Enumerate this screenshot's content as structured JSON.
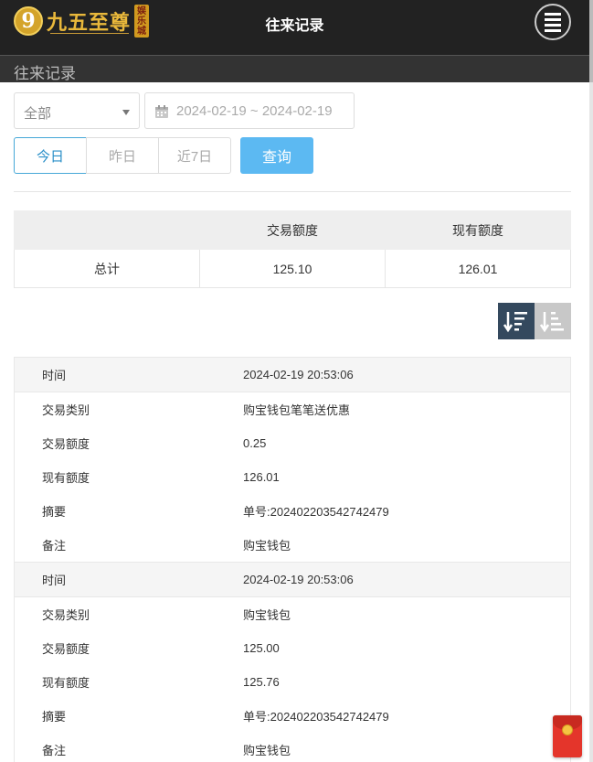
{
  "header": {
    "logo_mark": "9",
    "logo_text": "九五至尊",
    "logo_badge": "娱乐城",
    "title": "往来记录"
  },
  "subheader": {
    "title": "往来记录"
  },
  "filters": {
    "type_select": "全部",
    "date_range": "2024-02-19 ~ 2024-02-19",
    "quick_ranges": [
      "今日",
      "昨日",
      "近7日"
    ],
    "active_quick_range": "今日",
    "query_label": "查询"
  },
  "summary": {
    "columns": [
      "",
      "交易额度",
      "现有额度"
    ],
    "row": {
      "label": "总计",
      "trade_amount": "125.10",
      "balance": "126.01"
    }
  },
  "records": [
    {
      "time_label": "时间",
      "time": "2024-02-19 20:53:06",
      "type_label": "交易类别",
      "type": "购宝钱包笔笔送优惠",
      "amount_label": "交易额度",
      "amount": "0.25",
      "balance_label": "现有额度",
      "balance": "126.01",
      "summary_label": "摘要",
      "summary": "单号:202402203542742479",
      "note_label": "备注",
      "note": "购宝钱包"
    },
    {
      "time_label": "时间",
      "time": "2024-02-19 20:53:06",
      "type_label": "交易类别",
      "type": "购宝钱包",
      "amount_label": "交易额度",
      "amount": "125.00",
      "balance_label": "现有额度",
      "balance": "125.76",
      "summary_label": "摘要",
      "summary": "单号:202402203542742479",
      "note_label": "备注",
      "note": "购宝钱包"
    }
  ],
  "colors": {
    "topbar": "#222222",
    "accent_blue": "#5cb9f2",
    "sort_active": "#34495e",
    "red_packet": "#e4352b"
  }
}
